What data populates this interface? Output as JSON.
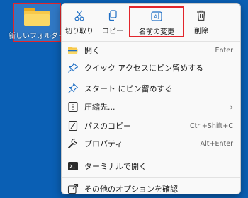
{
  "desktop": {
    "folder_label": "新しいフォルダー"
  },
  "toolbar": {
    "cut_label": "切り取り",
    "copy_label": "コピー",
    "rename_label": "名前の変更",
    "delete_label": "削除"
  },
  "menu": {
    "items": [
      {
        "label": "開く",
        "shortcut": "Enter",
        "icon": "folder-open-icon"
      },
      {
        "label": "クイック アクセスにピン留めする",
        "shortcut": "",
        "icon": "pin-icon"
      },
      {
        "label": "スタート にピン留めする",
        "shortcut": "",
        "icon": "pin-icon"
      },
      {
        "label": "圧縮先...",
        "shortcut": "",
        "icon": "archive-icon",
        "submenu": true
      },
      {
        "label": "パスのコピー",
        "shortcut": "Ctrl+Shift+C",
        "icon": "copy-path-icon"
      },
      {
        "label": "プロパティ",
        "shortcut": "Alt+Enter",
        "icon": "wrench-icon"
      },
      {
        "label": "ターミナルで開く",
        "shortcut": "",
        "icon": "terminal-icon"
      },
      {
        "label": "その他のオプションを確認",
        "shortcut": "",
        "icon": "share-icon"
      }
    ],
    "submenu_arrow": "›"
  },
  "colors": {
    "desktop_bg": "#0a5fb4",
    "highlight_border": "#e2252b",
    "accent_icon": "#1f6fc5"
  }
}
